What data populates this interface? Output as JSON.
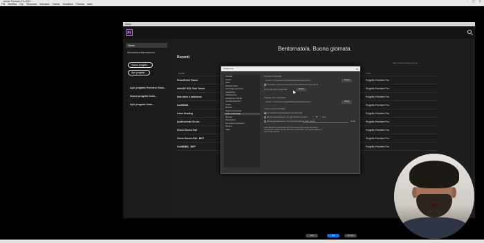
{
  "os": {
    "window_title": "Adobe Premiere Pro 2022",
    "menu": [
      "File",
      "Modifica",
      "Clip",
      "Sequenza",
      "Marcatori",
      "Grafica",
      "Visualizza",
      "Finestra",
      "Aiuto"
    ]
  },
  "home": {
    "window_title": "Home",
    "logo": "Pr",
    "sidebar": {
      "items": [
        "Home",
        "Sincronizza impostazioni"
      ],
      "new_project_button": "Nuovo progetto...",
      "open_project_button": "Apri progetto...",
      "links": [
        "Apri progetto Premiere Rush...",
        "Nuovo progetto team...",
        "Apri progetto team..."
      ]
    },
    "welcome": "Bentornato/a. Buona giornata.",
    "recents_title": "Recenti",
    "filter": "Filtra: parole chiave recenti",
    "columns": {
      "name": "NOME",
      "type": "TIPO"
    },
    "recent_projects": [
      {
        "name": "PowerPoint Teaser",
        "type": "Progetto Premiere Pro"
      },
      {
        "name": "InteVAE GOI: First Touch",
        "type": "Progetto Premiere Pro"
      },
      {
        "name": "Una video e antimusic",
        "type": "Progetto Premiere Pro"
      },
      {
        "name": "ConBVMA",
        "type": "Progetto Premiere Pro"
      },
      {
        "name": "Color Grading",
        "type": "Progetto Premiere Pro"
      },
      {
        "name": "Quali schede GI con",
        "type": "Progetto Premiere Pro"
      },
      {
        "name": "Green Screen Fail",
        "type": "Progetto Premiere Pro"
      },
      {
        "name": "Green Screen Fail - BKP",
        "type": "Progetto Premiere Pro"
      },
      {
        "name": "ConBMBA - BKP",
        "type": "Progetto Premiere Pro"
      }
    ]
  },
  "preferences": {
    "title": "Preferenze",
    "categories": [
      "Generale",
      "Aspetto",
      "Audio",
      "Hardware audio",
      "Salvataggio automatico",
      "Acquisizione",
      "Collaborazione",
      "Superficie di controllo",
      "Controllo dispositivo",
      "Grafica",
      "Etichette",
      "Supporti multimediali",
      "Cache multimediale",
      "Memoria",
      "Riproduzione",
      "Sincronizza impostazioni",
      "Timeline",
      "Taglio"
    ],
    "selected_category": "Cache multimediale",
    "media_cache_files_label": "File cache multimediale",
    "media_cache_files_path": "Percorso:  C:\\Users\\Pxxxx\\AppData\\Roaming\\Adobe\\Common",
    "browse_1": "Sfoglia",
    "save_next_to_originals": "Se possibile, salva i file della cache multimediale accanto agli originali",
    "remove_cache_files": "Rimuovi file cache multimediale",
    "remove_button": "Elimina",
    "media_cache_db_label": "Database cache multimediale",
    "media_cache_db_path": "Percorso:  C:\\Users\\Pxxxx\\AppData\\Roaming\\Adobe\\Common",
    "browse_2": "Sfoglia",
    "management_label": "Gestione cache multimediale",
    "option_none": "Non eliminare automaticamente i file della cache",
    "option_older": "Elimina automaticamente i file della cache più vecchi di",
    "option_older_value": "90",
    "option_older_unit": "giorni",
    "option_size": "Elimina automaticamente i file più vecchi quando la cache supera",
    "option_size_value": "20 GB",
    "note": "Il file della cache multimediale viene conservato nella cartella. Per evitare l'eliminazione inattesa dei file della cache multimediale, si consiglia di salvarli in una cartella dedicata.",
    "help_button": "Aiuto",
    "ok_button": "OK",
    "cancel_button": "Annulla"
  }
}
